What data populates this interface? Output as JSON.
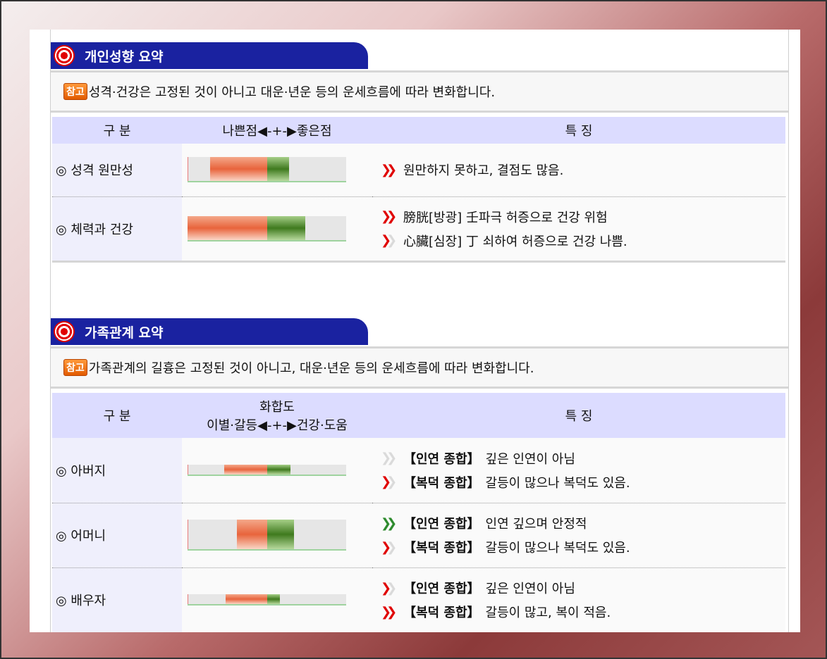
{
  "personality": {
    "title": "개인성향 요약",
    "note_badge": "참고",
    "note": "성격·건강은 고정된 것이 아니고 대운·년운 등의 운세흐름에 따라 변화합니다.",
    "headers": {
      "category": "구 분",
      "scale": "나쁜점◀-+-▶좋은점",
      "feature": "특 징"
    },
    "rows": [
      {
        "category": "◎ 성격 원만성",
        "bar": {
          "bad_start": 0.14,
          "center": 0.5,
          "good_end": 0.64
        },
        "lines": [
          {
            "chevron": "red-red",
            "text": "원만하지 못하고, 결점도 많음."
          }
        ]
      },
      {
        "category": "◎ 체력과 건강",
        "bar": {
          "bad_start": 0.0,
          "center": 0.5,
          "good_end": 0.74
        },
        "lines": [
          {
            "chevron": "red-red",
            "text": "膀胱[방광] 壬파극 허증으로 건강 위험"
          },
          {
            "chevron": "red-grey",
            "text": "心臟[심장] 丁 쇠하여 허증으로 건강 나쁨."
          }
        ]
      }
    ]
  },
  "family": {
    "title": "가족관계 요약",
    "note_badge": "참고",
    "note": "가족관계의 길흉은 고정된 것이 아니고, 대운·년운 등의 운세흐름에 따라 변화합니다.",
    "headers": {
      "category": "구 분",
      "scale_title": "화합도",
      "scale": "이별·갈등◀-+-▶건강·도움",
      "feature": "특 징"
    },
    "rows": [
      {
        "category": "◎ 아버지",
        "bar": {
          "bad_start": 0.23,
          "center": 0.5,
          "good_end": 0.65
        },
        "lines": [
          {
            "chevron": "grey-grey",
            "keyword": "【인연 종합】",
            "text": "깊은 인연이 아님"
          },
          {
            "chevron": "red-grey",
            "keyword": "【복덕 종합】",
            "text": "갈등이 많으나 복덕도 있음."
          }
        ]
      },
      {
        "category": "◎ 어머니",
        "bar": {
          "bad_start": 0.31,
          "center": 0.5,
          "good_end": 0.67
        },
        "lines": [
          {
            "chevron": "green-green",
            "keyword": "【인연 종합】",
            "text": "인연 깊으며 안정적"
          },
          {
            "chevron": "red-grey",
            "keyword": "【복덕 종합】",
            "text": "갈등이 많으나 복덕도 있음."
          }
        ]
      },
      {
        "category": "◎ 배우자",
        "bar": {
          "bad_start": 0.24,
          "center": 0.5,
          "good_end": 0.58
        },
        "lines": [
          {
            "chevron": "red-grey",
            "keyword": "【인연 종합】",
            "text": "깊은 인연이 아님"
          },
          {
            "chevron": "red-red",
            "keyword": "【복덕 종합】",
            "text": "갈등이 많고, 복이 적음."
          }
        ]
      }
    ]
  }
}
